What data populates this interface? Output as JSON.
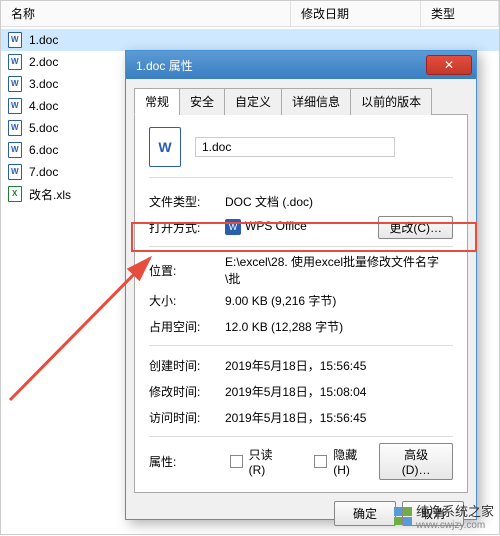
{
  "explorer": {
    "columns": {
      "name": "名称",
      "date": "修改日期",
      "type": "类型"
    },
    "files": [
      {
        "name": "1.doc",
        "type": "doc"
      },
      {
        "name": "2.doc",
        "type": "doc"
      },
      {
        "name": "3.doc",
        "type": "doc"
      },
      {
        "name": "4.doc",
        "type": "doc"
      },
      {
        "name": "5.doc",
        "type": "doc"
      },
      {
        "name": "6.doc",
        "type": "doc"
      },
      {
        "name": "7.doc",
        "type": "doc"
      },
      {
        "name": "改名.xls",
        "type": "xls"
      }
    ]
  },
  "dialog": {
    "title": "1.doc 属性",
    "tabs": {
      "general": "常规",
      "security": "安全",
      "custom": "自定义",
      "details": "详细信息",
      "previous": "以前的版本"
    },
    "filename": "1.doc",
    "rows": {
      "filetype_label": "文件类型:",
      "filetype_value": "DOC 文档 (.doc)",
      "openwith_label": "打开方式:",
      "openwith_value": "WPS Office",
      "change_btn": "更改(C)…",
      "location_label": "位置:",
      "location_value": "E:\\excel\\28. 使用excel批量修改文件名字\\批",
      "size_label": "大小:",
      "size_value": "9.00 KB (9,216 字节)",
      "size_on_disk_label": "占用空间:",
      "size_on_disk_value": "12.0 KB (12,288 字节)",
      "created_label": "创建时间:",
      "created_value": "2019年5月18日，15:56:45",
      "modified_label": "修改时间:",
      "modified_value": "2019年5月18日，15:08:04",
      "accessed_label": "访问时间:",
      "accessed_value": "2019年5月18日，15:56:45",
      "attributes_label": "属性:",
      "readonly_label": "只读(R)",
      "hidden_label": "隐藏(H)",
      "advanced_btn": "高级(D)…"
    },
    "buttons": {
      "ok": "确定",
      "cancel": "取消"
    }
  },
  "watermark": {
    "brand": "纯净系统之家",
    "url": "www.cwjzy.com"
  }
}
